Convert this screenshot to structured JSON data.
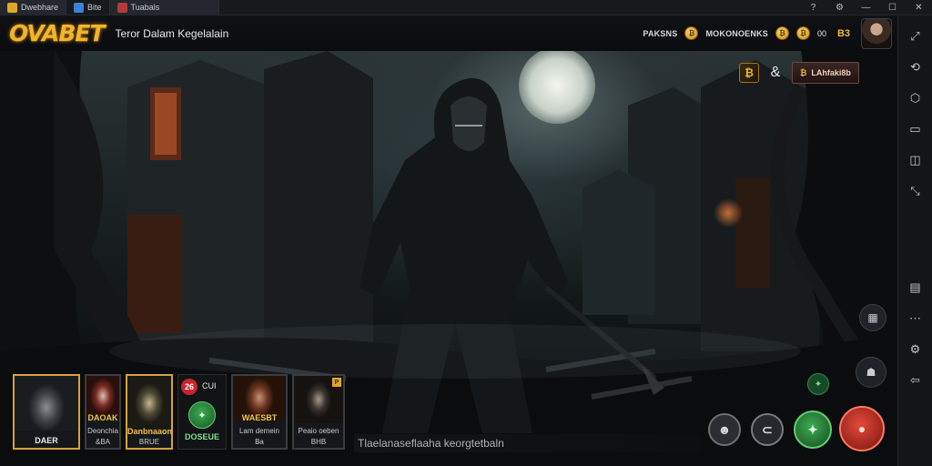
{
  "window": {
    "tabs": [
      {
        "label": "Dwebhare",
        "icon": "app-logo-icon"
      },
      {
        "label": "Bite",
        "icon": "browser-icon"
      },
      {
        "label": "Tuabals",
        "icon": "game-tab-icon"
      }
    ],
    "controls": [
      "?",
      "⚙",
      "—",
      "☐",
      "✕"
    ]
  },
  "header": {
    "logo": "OVABET",
    "title": "Teror Dalam Kegelalain",
    "items": [
      {
        "label": "PAKSNS"
      },
      {
        "label": "MOKONOENKS"
      }
    ],
    "coin_symbol": "₿",
    "value": "00",
    "flag_symbol": "B3"
  },
  "game_controls": {
    "coin_symbol": "₿",
    "link_symbol": "&",
    "button_label": "LAhfaki8b"
  },
  "cards": [
    {
      "caption": "DAER",
      "sub": ""
    },
    {
      "caption": "DAOAK",
      "sub2": "Deonchia",
      "sub3": "&BA"
    },
    {
      "caption": "Danbnaaon",
      "sub": "BRUE"
    },
    {
      "badge": "26",
      "label": "CUI",
      "caption": "DOSEUE"
    },
    {
      "caption": "WAESBT",
      "sub": "Lam demein",
      "sub2": "Ba"
    },
    {
      "caption": "",
      "sub": "Peaio oeben",
      "sub2": "BHB",
      "tag": "P"
    }
  ],
  "ticker": "Tlaelanaseflaaha keorgtetbaln",
  "actions": {
    "a1": "☻",
    "a2": "⊂",
    "a3": "✦",
    "a4": "●"
  },
  "colors": {
    "accent_gold": "#f1b52a",
    "action_green": "#3ea852",
    "action_red": "#e24a3a"
  }
}
